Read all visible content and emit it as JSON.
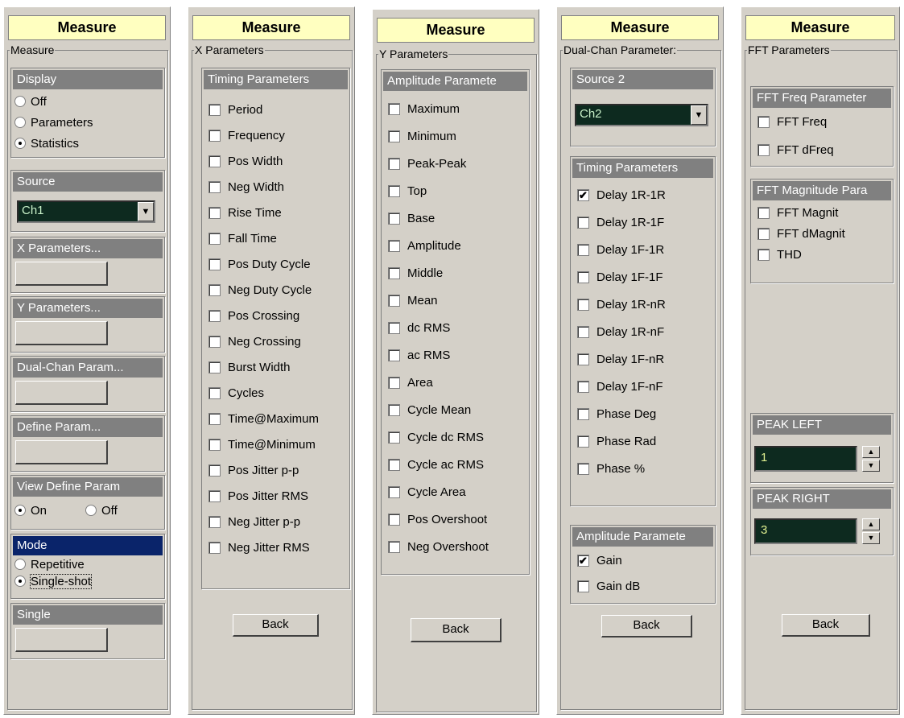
{
  "measure_panel": {
    "title": "Measure",
    "frame_label": "Measure",
    "display": {
      "header": "Display",
      "options": [
        "Off",
        "Parameters",
        "Statistics"
      ],
      "selected": "Statistics"
    },
    "source": {
      "header": "Source",
      "value": "Ch1"
    },
    "x_params": {
      "header": "X Parameters..."
    },
    "y_params": {
      "header": "Y Parameters..."
    },
    "dual_params": {
      "header": "Dual-Chan Param..."
    },
    "define_param": {
      "header": "Define Param..."
    },
    "view_define": {
      "header": "View Define Param",
      "on": "On",
      "off": "Off",
      "selected": "On"
    },
    "mode": {
      "header": "Mode",
      "options": [
        "Repetitive",
        "Single-shot"
      ],
      "selected": "Single-shot"
    },
    "single": {
      "header": "Single"
    }
  },
  "x_panel": {
    "title": "Measure",
    "frame_label": "X Parameters",
    "group_header": "Timing Parameters",
    "items": [
      "Period",
      "Frequency",
      "Pos Width",
      "Neg Width",
      "Rise Time",
      "Fall Time",
      "Pos Duty Cycle",
      "Neg Duty Cycle",
      "Pos Crossing",
      "Neg Crossing",
      "Burst Width",
      "Cycles",
      "Time@Maximum",
      "Time@Minimum",
      "Pos Jitter p-p",
      "Pos Jitter RMS",
      "Neg Jitter p-p",
      "Neg Jitter RMS"
    ],
    "back_label": "Back"
  },
  "y_panel": {
    "title": "Measure",
    "frame_label": "Y Parameters",
    "group_header": "Amplitude Paramete",
    "items": [
      "Maximum",
      "Minimum",
      "Peak-Peak",
      "Top",
      "Base",
      "Amplitude",
      "Middle",
      "Mean",
      "dc RMS",
      "ac RMS",
      "Area",
      "Cycle Mean",
      "Cycle dc RMS",
      "Cycle ac RMS",
      "Cycle Area",
      "Pos Overshoot",
      "Neg Overshoot"
    ],
    "back_label": "Back"
  },
  "dual_panel": {
    "title": "Measure",
    "frame_label": "Dual-Chan Parameter:",
    "source2": {
      "header": "Source 2",
      "value": "Ch2"
    },
    "timing_header": "Timing Parameters",
    "timing_items": [
      "Delay 1R-1R",
      "Delay 1R-1F",
      "Delay 1F-1R",
      "Delay 1F-1F",
      "Delay 1R-nR",
      "Delay 1R-nF",
      "Delay 1F-nR",
      "Delay 1F-nF",
      "Phase Deg",
      "Phase Rad",
      "Phase %"
    ],
    "timing_checked": [
      true,
      false,
      false,
      false,
      false,
      false,
      false,
      false,
      false,
      false,
      false
    ],
    "amp_header": "Amplitude Paramete",
    "amp_items": [
      "Gain",
      "Gain dB"
    ],
    "amp_checked": [
      true,
      false
    ],
    "back_label": "Back"
  },
  "fft_panel": {
    "title": "Measure",
    "frame_label": "FFT Parameters",
    "freq_header": "FFT Freq Parameter",
    "freq_items": [
      "FFT Freq",
      "FFT dFreq"
    ],
    "mag_header": "FFT Magnitude Para",
    "mag_items": [
      "FFT Magnit",
      "FFT dMagnit",
      "THD"
    ],
    "peak_left": {
      "header": "PEAK LEFT",
      "value": "1"
    },
    "peak_right": {
      "header": "PEAK RIGHT",
      "value": "3"
    },
    "back_label": "Back"
  },
  "icons": {
    "dropdown": "chevron-down-icon",
    "spin_up": "arrow-up-icon",
    "spin_down": "arrow-down-icon",
    "check": "checkmark-icon"
  }
}
